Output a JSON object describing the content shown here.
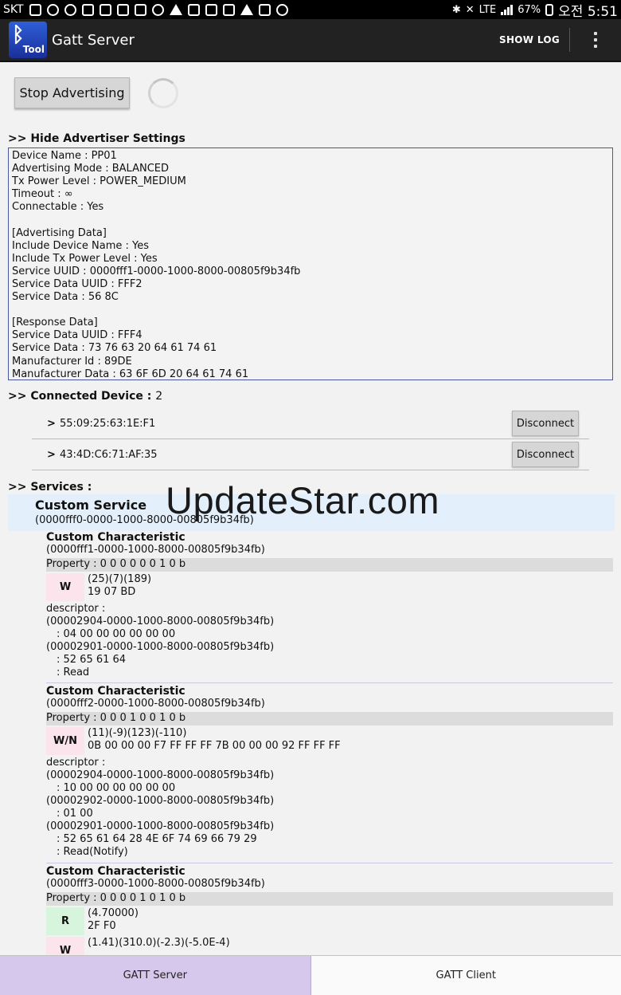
{
  "status_bar": {
    "carrier": "SKT",
    "network": "LTE",
    "battery": "67%",
    "time": "오전 5:51"
  },
  "action_bar": {
    "app_icon_label": "Tool",
    "title": "Gatt Server",
    "show_log": "SHOW LOG"
  },
  "advertising": {
    "button_label": "Stop Advertising",
    "settings_header": ">> Hide Advertiser Settings",
    "lines": [
      "Device Name : PP01",
      "Advertising Mode : BALANCED",
      "Tx Power Level : POWER_MEDIUM",
      "Timeout : ∞",
      "Connectable : Yes",
      "",
      "[Advertising Data]",
      "Include Device Name : Yes",
      "Include Tx Power Level : Yes",
      "Service UUID : 0000fff1-0000-1000-8000-00805f9b34fb",
      "Service Data UUID : FFF2",
      "Service Data : 56 8C",
      "",
      "[Response Data]",
      "Service Data UUID : FFF4",
      "Service Data : 73 76 63 20 64 61 74 61",
      "Manufacturer Id : 89DE",
      "Manufacturer Data : 63 6F 6D 20 64 61 74 61"
    ]
  },
  "connected": {
    "header": ">> Connected Device :",
    "count": "2",
    "devices": [
      {
        "chevron": ">",
        "address": "55:09:25:63:1E:F1",
        "button": "Disconnect"
      },
      {
        "chevron": ">",
        "address": "43:4D:C6:71:AF:35",
        "button": "Disconnect"
      }
    ]
  },
  "services": {
    "header": ">> Services :",
    "service_name": "Custom Service",
    "service_uuid": "(0000fff0-0000-1000-8000-00805f9b34fb)",
    "characteristics": [
      {
        "name": "Custom Characteristic",
        "uuid": "(0000fff1-0000-1000-8000-00805f9b34fb)",
        "property": "Property :  0 0 0 0 0 0 1 0 b",
        "badge": "W",
        "values": [
          "(25)(7)(189)",
          "19 07 BD"
        ],
        "descriptor_label": "descriptor :",
        "descriptors": [
          {
            "uuid": "(00002904-0000-1000-8000-00805f9b34fb)",
            "value": ": 04 00 00 00 00 00 00"
          },
          {
            "uuid": "(00002901-0000-1000-8000-00805f9b34fb)",
            "value": ": 52 65 61 64",
            "extra": ": Read"
          }
        ]
      },
      {
        "name": "Custom Characteristic",
        "uuid": "(0000fff2-0000-1000-8000-00805f9b34fb)",
        "property": "Property :  0 0 0 1 0 0 1 0 b",
        "badge": "W/N",
        "values": [
          "(11)(-9)(123)(-110)",
          "0B 00 00 00 F7 FF FF FF 7B 00 00 00 92 FF FF FF"
        ],
        "descriptor_label": "descriptor :",
        "descriptors": [
          {
            "uuid": "(00002904-0000-1000-8000-00805f9b34fb)",
            "value": ": 10 00 00 00 00 00 00"
          },
          {
            "uuid": "(00002902-0000-1000-8000-00805f9b34fb)",
            "value": ": 01 00"
          },
          {
            "uuid": "(00002901-0000-1000-8000-00805f9b34fb)",
            "value": ": 52 65 61 64 28 4E 6F 74 69 66 79 29",
            "extra": ": Read(Notify)"
          }
        ]
      },
      {
        "name": "Custom Characteristic",
        "uuid": "(0000fff3-0000-1000-8000-00805f9b34fb)",
        "property": "Property :  0 0 0 0 1 0 1 0 b",
        "badge": "R",
        "values": [
          "(4.70000)",
          "2F F0"
        ],
        "badge2": "W",
        "values2": [
          "(1.41)(310.0)(-2.3)(-5.0E-4)"
        ]
      }
    ]
  },
  "watermark": "UpdateStar.com",
  "tabs": {
    "server": "GATT Server",
    "client": "GATT Client"
  },
  "colors": {
    "active_tab": "#d5c8ec",
    "service_header": "#e3effa",
    "write_badge": "#fbe4ec",
    "read_badge": "#d6f5dc",
    "action_bar": "#222222"
  }
}
